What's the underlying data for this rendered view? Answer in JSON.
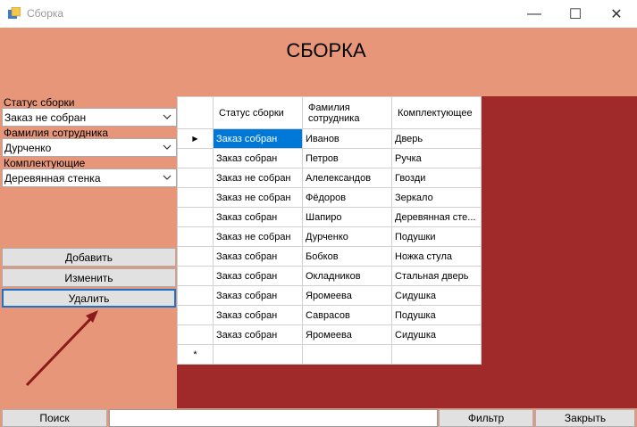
{
  "window": {
    "title": "Сборка",
    "controls": {
      "minimize": "—",
      "maximize": "☐",
      "close": "✕"
    }
  },
  "heading": "СБОРКА",
  "form": {
    "status_label": "Статус сборки",
    "status_value": "Заказ не собран",
    "employee_label": "Фамилия сотрудника",
    "employee_value": "Дурченко",
    "component_label": "Комплектующие",
    "component_value": "Деревянная стенка"
  },
  "buttons": {
    "add": "Добавить",
    "edit": "Изменить",
    "delete": "Удалить"
  },
  "grid": {
    "columns": [
      "Статус сборки",
      "Фамилия сотрудника",
      "Комплектующее"
    ],
    "rows": [
      [
        "Заказ собран",
        "Иванов",
        "Дверь"
      ],
      [
        "Заказ собран",
        "Петров",
        "Ручка"
      ],
      [
        "Заказ не собран",
        "Алелександов",
        "Гвозди"
      ],
      [
        "Заказ не собран",
        "Фёдоров",
        "Зеркало"
      ],
      [
        "Заказ собран",
        "Шапиро",
        "Деревянная сте..."
      ],
      [
        "Заказ не собран",
        "Дурченко",
        "Подушки"
      ],
      [
        "Заказ собран",
        "Бобков",
        "Ножка стула"
      ],
      [
        "Заказ собран",
        "Окладников",
        "Стальная дверь"
      ],
      [
        "Заказ собран",
        "Яромеева",
        "Сидушка"
      ],
      [
        "Заказ собран",
        "Саврасов",
        "Подушка"
      ],
      [
        "Заказ собран",
        "Яромеева",
        "Сидушка"
      ]
    ],
    "current_row_marker": "▶",
    "new_row_marker": "*"
  },
  "footer": {
    "search": "Поиск",
    "search_value": "",
    "filter": "Фильтр",
    "close": "Закрыть"
  },
  "colors": {
    "background": "#e8967a",
    "grid_background": "#a02a2a",
    "selection": "#0078d7",
    "arrow": "#8b1a1a"
  }
}
